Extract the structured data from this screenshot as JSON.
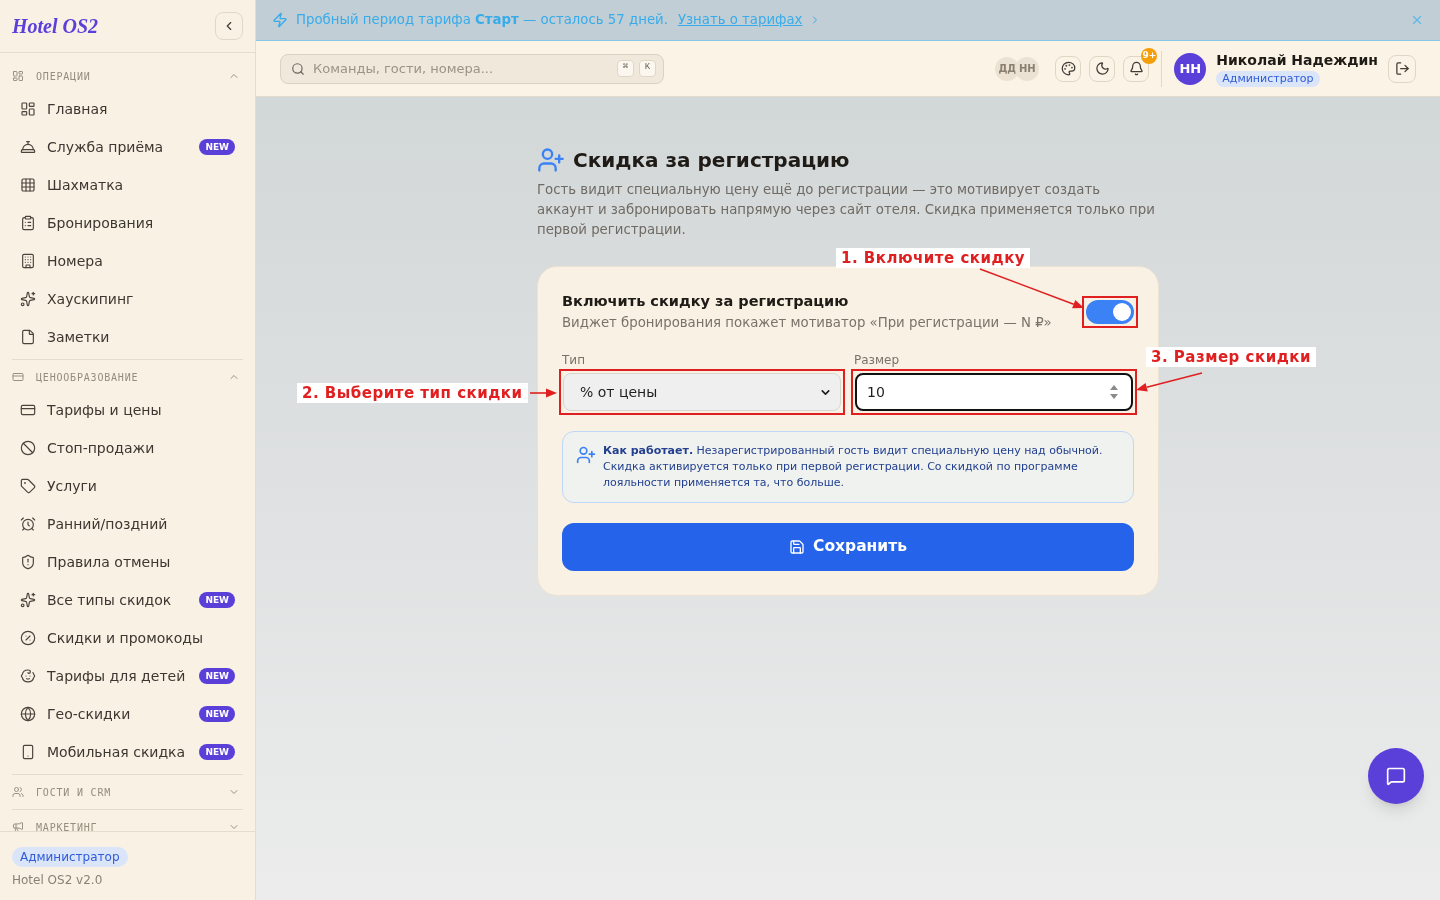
{
  "sidebar": {
    "logo": "Hotel OS2",
    "sections": [
      {
        "title": "ОПЕРАЦИИ",
        "expanded": true,
        "items": [
          {
            "label": "Главная"
          },
          {
            "label": "Служба приёма",
            "badge": "NEW"
          },
          {
            "label": "Шахматка"
          },
          {
            "label": "Бронирования"
          },
          {
            "label": "Номера"
          },
          {
            "label": "Хаускипинг"
          },
          {
            "label": "Заметки"
          }
        ]
      },
      {
        "title": "ЦЕНООБРАЗОВАНИЕ",
        "expanded": true,
        "items": [
          {
            "label": "Тарифы и цены"
          },
          {
            "label": "Стоп-продажи"
          },
          {
            "label": "Услуги"
          },
          {
            "label": "Ранний/поздний"
          },
          {
            "label": "Правила отмены"
          },
          {
            "label": "Все типы скидок",
            "badge": "NEW"
          },
          {
            "label": "Скидки и промокоды"
          },
          {
            "label": "Тарифы для детей",
            "badge": "NEW"
          },
          {
            "label": "Гео-скидки",
            "badge": "NEW"
          },
          {
            "label": "Мобильная скидка",
            "badge": "NEW"
          }
        ]
      },
      {
        "title": "ГОСТИ И CRM",
        "expanded": false
      },
      {
        "title": "МАРКЕТИНГ",
        "expanded": false
      }
    ],
    "footer": {
      "role": "Администратор",
      "version": "Hotel OS2 v2.0"
    }
  },
  "banner": {
    "text": "Пробный период тарифа **Старт** — осталось 57 дней.",
    "link": "Узнать о тарифах"
  },
  "topbar": {
    "search": {
      "placeholder": "Команды, гости, номера...",
      "shortcut": [
        "⌘",
        "K"
      ]
    },
    "presence": [
      "ДД",
      "НН"
    ],
    "notifications": "9+",
    "user": {
      "initials": "НН",
      "name": "Николай Надеждин",
      "role": "Администратор"
    }
  },
  "page": {
    "title": "Скидка за регистрацию",
    "description": "Гость видит специальную цену ещё до регистрации — это мотивирует создать аккаунт и забронировать напрямую через сайт отеля. Скидка применяется только при первой регистрации.",
    "card": {
      "toggle": {
        "label": "Включить скидку за регистрацию",
        "hint": "Виджет бронирования покажет мотиватор «При регистрации — N ₽»",
        "on": true
      },
      "type": {
        "label": "Тип",
        "value": "% от цены"
      },
      "size": {
        "label": "Размер",
        "value": "10"
      },
      "info": "**Как работает.** Незарегистрированный гость видит специальную цену над обычной. Скидка активируется только при первой регистрации. Со скидкой по программе лояльности применяется та, что больше.",
      "save": "Сохранить"
    }
  },
  "annotations": [
    {
      "label": "1. Включите скидку"
    },
    {
      "label": "2. Выберите тип скидки"
    },
    {
      "label": "3. Размер скидки"
    }
  ]
}
